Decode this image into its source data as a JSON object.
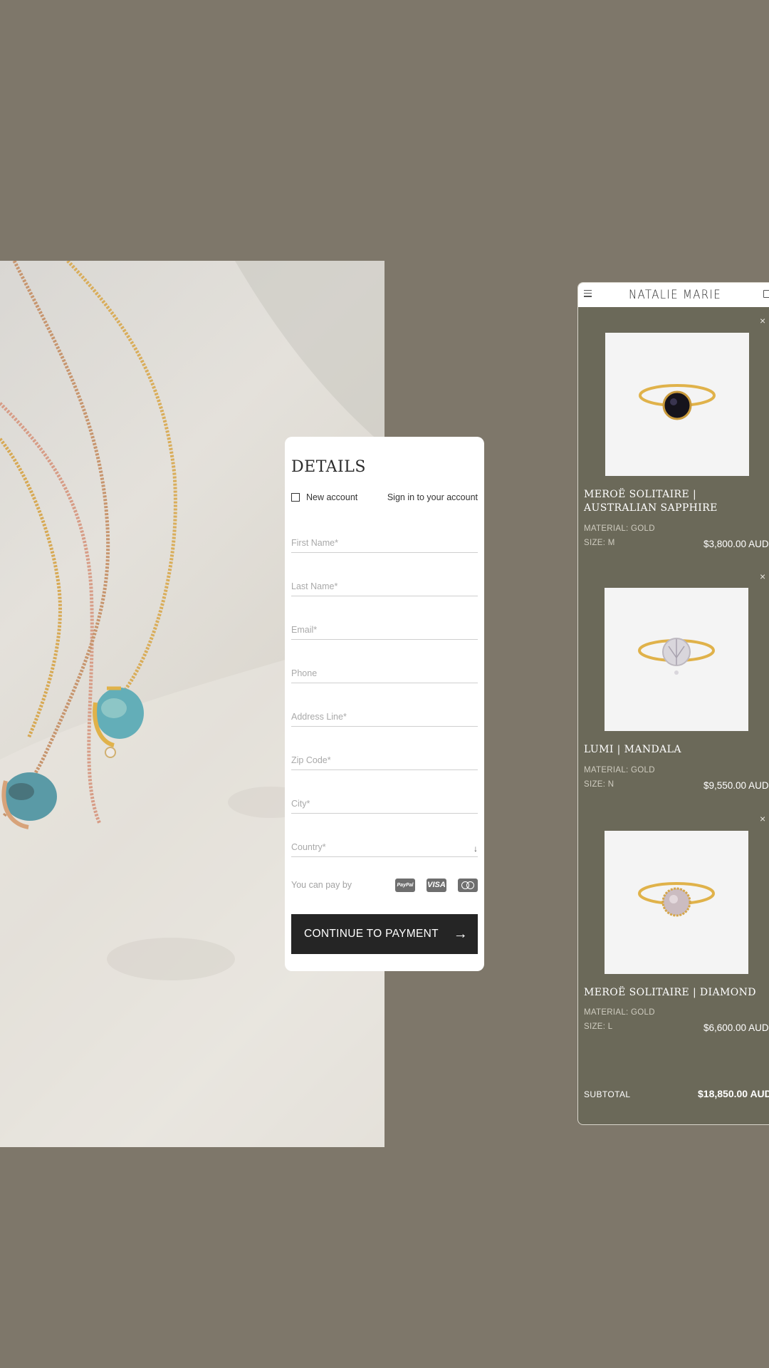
{
  "form": {
    "title": "DETAILS",
    "new_account_label": "New account",
    "sign_in_label": "Sign in to your account",
    "fields": {
      "first_name": "First Name*",
      "last_name": "Last Name*",
      "email": "Email*",
      "phone": "Phone",
      "address": "Address Line*",
      "zip": "Zip Code*",
      "city": "City*",
      "country": "Country*"
    },
    "country_arrow": "↓",
    "pay_label": "You can pay by",
    "payment_methods": {
      "paypal": "PayPal",
      "visa": "VISA"
    },
    "cta_label": "CONTINUE TO PAYMENT",
    "cta_arrow": "→"
  },
  "cart": {
    "brand": "NATALIE MARIE",
    "remove_glyph": "×",
    "items": [
      {
        "name": "MEROË SOLITAIRE | AUSTRALIAN SAPPHIRE",
        "material": "MATERIAL: GOLD",
        "size": "SIZE: M",
        "price": "$3,800.00 AUD",
        "stone_color": "#15131c"
      },
      {
        "name": "LUMI | MANDALA",
        "material": "MATERIAL: GOLD",
        "size": "SIZE: N",
        "price": "$9,550.00 AUD",
        "stone_color": "#d9d6dc"
      },
      {
        "name": "MEROË SOLITAIRE | DIAMOND",
        "material": "MATERIAL: GOLD",
        "size": "SIZE: L",
        "price": "$6,600.00 AUD",
        "stone_color": "#cbbcc1"
      }
    ],
    "subtotal_label": "SUBTOTAL",
    "subtotal_value": "$18,850.00 AUD"
  },
  "colors": {
    "background": "#7e776a",
    "cart_background": "#6b6959",
    "button": "#252525",
    "gold": "#e0b24a",
    "opal": "#63aeb8"
  }
}
